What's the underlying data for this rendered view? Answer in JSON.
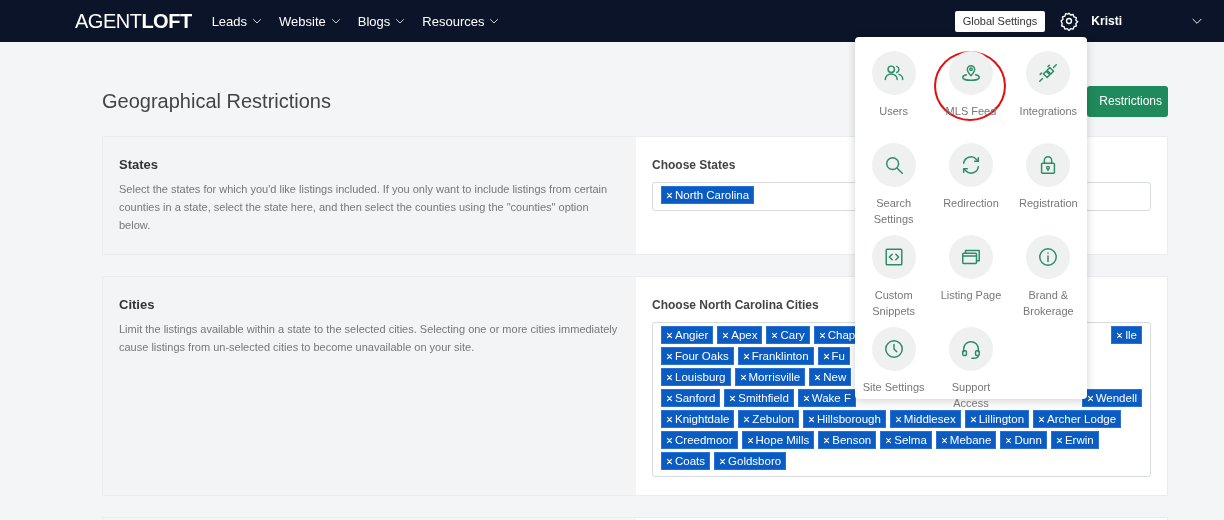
{
  "nav": {
    "logo_light": "AGENT",
    "logo_bold": "LOFT",
    "menus": [
      {
        "label": "Leads"
      },
      {
        "label": "Website"
      },
      {
        "label": "Blogs"
      },
      {
        "label": "Resources"
      }
    ],
    "global_settings": "Global Settings",
    "user": "Kristi"
  },
  "page_title": "Geographical Restrictions",
  "action_button": "Restrictions",
  "sections": [
    {
      "title": "States",
      "description": "Select the states for which you'd like listings included. If you only want to include listings from certain counties in a state, select the state here, and then select the counties using the \"counties\" option below.",
      "field_label": "Choose States",
      "tag_rows": [
        {
          "left": [
            "North Carolina"
          ],
          "right": []
        }
      ]
    },
    {
      "title": "Cities",
      "description": "Limit the listings available within a state to the selected cities. Selecting one or more cities immediately cause listings from un-selected cities to become unavailable on your site.",
      "field_label": "Choose North Carolina Cities",
      "tag_rows": [
        {
          "left": [
            "Angier",
            "Apex",
            "Cary",
            "Chap"
          ],
          "right": [
            "lle"
          ]
        },
        {
          "left": [
            "Four Oaks",
            "Franklinton",
            "Fu"
          ],
          "right": []
        },
        {
          "left": [
            "Louisburg",
            "Morrisville",
            "New"
          ],
          "right": []
        },
        {
          "left": [
            "Sanford",
            "Smithfield",
            "Wake F"
          ],
          "right": [
            "Wendell"
          ]
        },
        {
          "left": [
            "Knightdale",
            "Zebulon",
            "Hillsborough",
            "Middlesex",
            "Lillington",
            "Archer Lodge"
          ],
          "right": []
        },
        {
          "left": [
            "Creedmoor",
            "Hope Mills",
            "Benson",
            "Selma",
            "Mebane",
            "Dunn",
            "Erwin"
          ],
          "right": []
        },
        {
          "left": [
            "Coats",
            "Goldsboro"
          ],
          "right": []
        }
      ]
    }
  ],
  "settings_menu": {
    "items": [
      {
        "label": "Users",
        "highlighted": false
      },
      {
        "label": "MLS Feed",
        "highlighted": true
      },
      {
        "label": "Integrations",
        "highlighted": false
      },
      {
        "label": "Search Settings",
        "highlighted": false
      },
      {
        "label": "Redirection",
        "highlighted": false
      },
      {
        "label": "Registration",
        "highlighted": false
      },
      {
        "label": "Custom Snippets",
        "highlighted": false
      },
      {
        "label": "Listing Page",
        "highlighted": false
      },
      {
        "label": "Brand & Brokerage",
        "highlighted": false
      },
      {
        "label": "Site Settings",
        "highlighted": false
      },
      {
        "label": "Support Access",
        "highlighted": false
      }
    ]
  }
}
